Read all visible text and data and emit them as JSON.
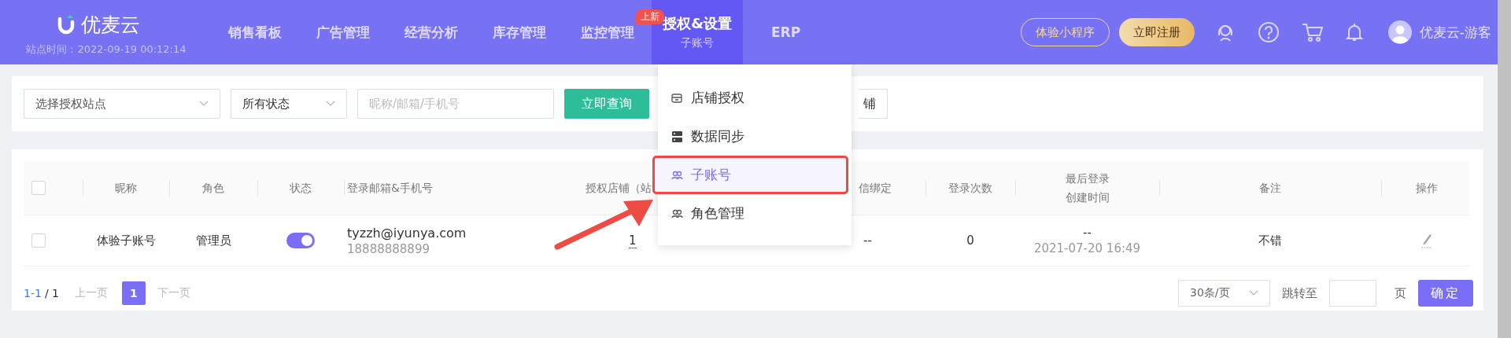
{
  "header": {
    "logo": "优麦云",
    "site_time": "站点时间：2022-09-19 00:12:14",
    "nav": [
      {
        "label": "销售看板",
        "selected": false
      },
      {
        "label": "广告管理",
        "selected": false
      },
      {
        "label": "经营分析",
        "selected": false
      },
      {
        "label": "库存管理",
        "selected": false
      },
      {
        "label": "监控管理",
        "selected": false
      },
      {
        "label": "授权&设置",
        "sublabel": "子账号",
        "badge": "上新",
        "selected": true
      },
      {
        "label": "ERP",
        "selected": false
      }
    ],
    "buttons": [
      {
        "label": "体验小程序",
        "kind": "outline"
      },
      {
        "label": "立即注册",
        "kind": "gold"
      }
    ],
    "user": "优麦云-游客"
  },
  "filters": {
    "site_select": "选择授权站点",
    "status_select": "所有状态",
    "search": {
      "placeholder": "昵称/邮箱/手机号"
    },
    "query_button": "立即查询",
    "partial_button": "铺"
  },
  "menu": {
    "items": [
      {
        "label": "店铺授权",
        "kind": "store",
        "selected": false,
        "highlighted": false
      },
      {
        "label": "数据同步",
        "kind": "server",
        "selected": false,
        "highlighted": false
      },
      {
        "label": "子账号",
        "kind": "users",
        "selected": true,
        "highlighted": true
      },
      {
        "label": "角色管理",
        "kind": "users",
        "selected": false,
        "highlighted": false
      }
    ]
  },
  "pointer_arrow": true,
  "table": {
    "select_all": {
      "checked": false
    },
    "columns": [
      {
        "lines": [
          "昵称"
        ]
      },
      {
        "lines": [
          "角色"
        ]
      },
      {
        "lines": [
          "状态"
        ]
      },
      {
        "lines": [
          "登录邮箱&手机号"
        ]
      },
      {
        "lines": [
          "授权店铺（站"
        ]
      },
      {
        "lines": [
          "信绑定"
        ]
      },
      {
        "lines": [
          "登录次数"
        ]
      },
      {
        "lines": [
          "最后登录",
          "创建时间"
        ]
      },
      {
        "lines": [
          "备注"
        ]
      },
      {
        "lines": [
          "操作"
        ]
      }
    ],
    "rows": [
      {
        "checked": false,
        "nickname": "体验子账号",
        "role": "管理员",
        "status_on": true,
        "email": "tyzzh@iyunya.com",
        "phone": "18888888899",
        "shops": "1",
        "wechat": "--",
        "login_count": "0",
        "last_login": "--",
        "created": "2021-07-20 16:49",
        "remark": "不错"
      }
    ]
  },
  "pagination": {
    "range": "1-1",
    "total": "/ 1",
    "prev": "上一页",
    "pages": [
      {
        "label": "1",
        "selected": true
      }
    ],
    "next": "下一页",
    "page_size": "30条/页",
    "jump_label": "跳转至",
    "page_unit": "页",
    "confirm": "确定"
  }
}
